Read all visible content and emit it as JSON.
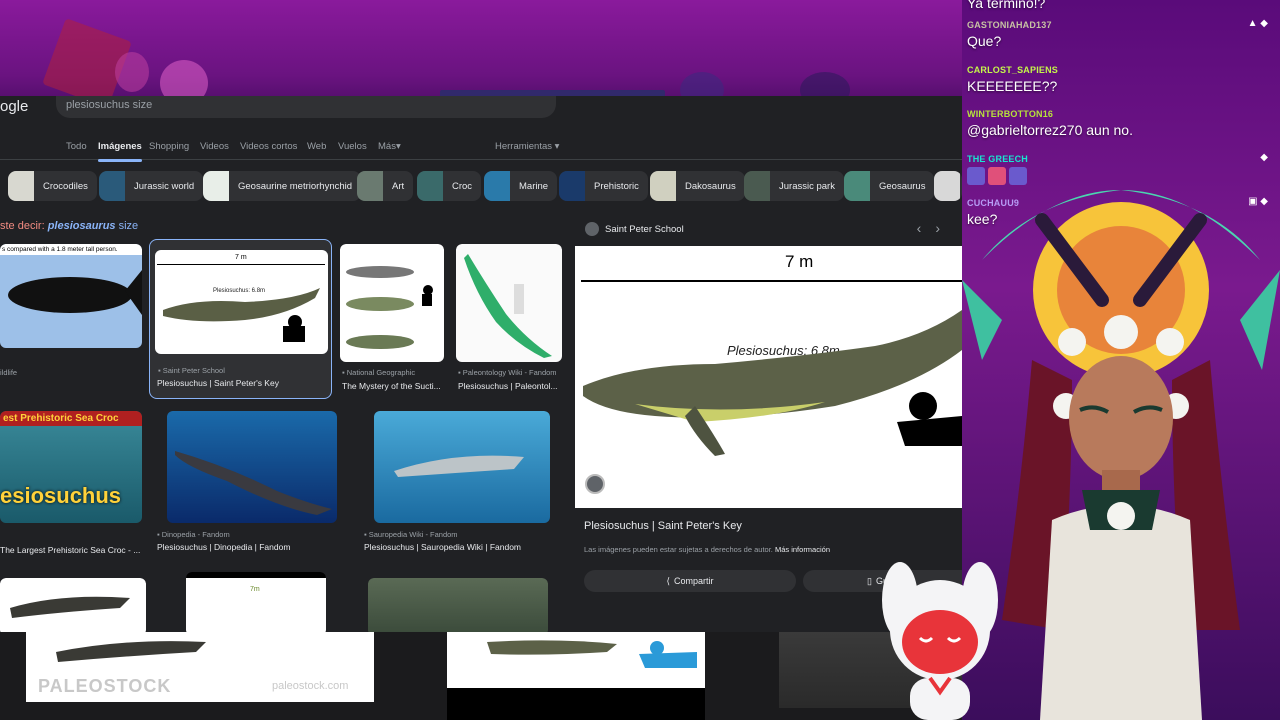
{
  "colors": {
    "chat_user_colors": [
      "#c7c2a3",
      "#c4f54a",
      "#b7e33b",
      "#17e6d0",
      "#b79cf5"
    ],
    "link": "#8ab4f8",
    "suggestion": "#f28b82"
  },
  "browser": {
    "logo_fragment": "ogle",
    "search_query": "plesiosuchus size",
    "tabs": [
      "Todo",
      "Imágenes",
      "Shopping",
      "Videos",
      "Videos cortos",
      "Web",
      "Vuelos",
      "Más"
    ],
    "tools_label": "Herramientas",
    "chips": [
      "Crocodiles",
      "Jurassic world",
      "Geosaurine metriorhynchid",
      "Art",
      "Croc",
      "Marine",
      "Prehistoric",
      "Dakosaurus",
      "Jurassic park",
      "Geosaurus"
    ],
    "did_you_mean": {
      "prefix": "ste decir: ",
      "term": "plesiosaurus",
      "suffix": " size"
    },
    "results": [
      {
        "caption": "s compared with a 1.8 meter tall person.",
        "source": "ildlife",
        "title": ""
      },
      {
        "label": "7 m",
        "inner_label": "Plesiosuchus: 6.8m",
        "source": "Saint Peter School",
        "title": "Plesiosuchus | Saint Peter's Key"
      },
      {
        "source": "National Geographic",
        "title": "The Mystery of the Sucti..."
      },
      {
        "source": "Paleontology Wiki - Fandom",
        "title": "Plesiosuchus | Paleontol..."
      },
      {
        "banner": "est Prehistoric Sea Croc",
        "big": "esiosuchus",
        "source": "",
        "title": "The Largest Prehistoric Sea Croc - ..."
      },
      {
        "source": "Dinopedia - Fandom",
        "title": "Plesiosuchus | Dinopedia | Fandom"
      },
      {
        "source": "Sauropedia Wiki - Fandom",
        "title": "Plesiosuchus | Sauropedia Wiki | Fandom"
      }
    ],
    "preview": {
      "source": "Saint Peter School",
      "scale_label": "7 m",
      "inner_label": "Plesiosuchus: 6.8m",
      "title": "Plesiosuchus | Saint Peter's Key",
      "copyright": "Las imágenes pueden estar sujetas a derechos de autor. ",
      "more_info": "Más información",
      "share_label": "Compartir",
      "save_label": "Guardar"
    },
    "bottom": {
      "watermark": "PALEOSTOCK",
      "watermark_url": "paleostock.com",
      "thumb_label": "7m"
    }
  },
  "chat": {
    "top_fragment": "Ya termino!?",
    "messages": [
      {
        "user": "GASTONIAHAD137",
        "text": "Que?"
      },
      {
        "user": "CARLOST_SAPIENS",
        "text": "KEEEEEEE??"
      },
      {
        "user": "WINTERBOTTON16",
        "text": "@gabrieltorrez270 aun no."
      },
      {
        "user": "THE GREECH",
        "text": ""
      },
      {
        "user": "CUCHAUU9",
        "text": "kee?"
      }
    ]
  }
}
